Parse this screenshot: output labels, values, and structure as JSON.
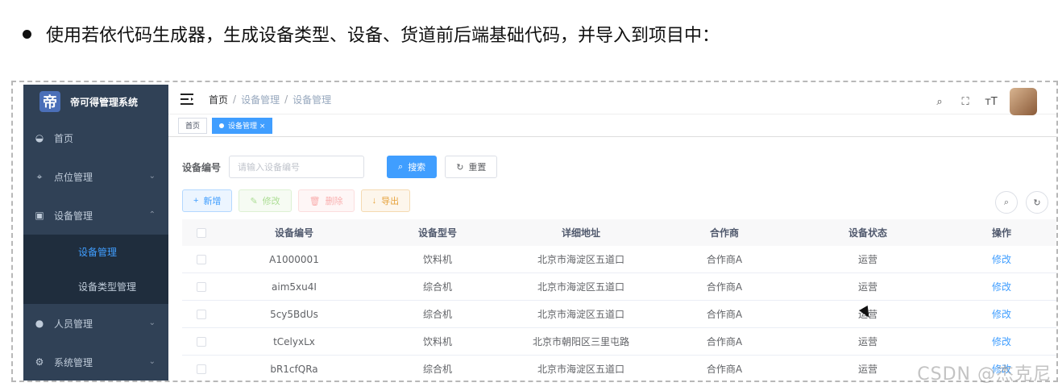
{
  "headline": "使用若依代码生成器，生成设备类型、设备、货道前后端基础代码，并导入到项目中：",
  "app": {
    "title": "帝可得管理系统",
    "logo_char": "帝"
  },
  "sidebar": {
    "items": [
      {
        "label": "首页",
        "icon": "dashboard-icon"
      },
      {
        "label": "点位管理",
        "icon": "location-icon"
      },
      {
        "label": "设备管理",
        "icon": "device-icon"
      },
      {
        "label": "人员管理",
        "icon": "people-icon"
      },
      {
        "label": "系统管理",
        "icon": "gear-icon"
      }
    ],
    "subitems": [
      {
        "label": "设备管理",
        "active": true
      },
      {
        "label": "设备类型管理",
        "active": false
      }
    ]
  },
  "breadcrumb": [
    "首页",
    "设备管理",
    "设备管理"
  ],
  "tags": [
    "首页",
    "设备管理 ×"
  ],
  "search": {
    "label": "设备编号",
    "placeholder": "请输入设备编号",
    "search_label": "搜索",
    "reset_label": "重置"
  },
  "actions": [
    "新增",
    "修改",
    "删除",
    "导出"
  ],
  "table": {
    "headers": [
      "设备编号",
      "设备型号",
      "详细地址",
      "合作商",
      "设备状态",
      "操作"
    ],
    "rows": [
      [
        "A1000001",
        "饮料机",
        "北京市海淀区五道口",
        "合作商A",
        "运营",
        "修改"
      ],
      [
        "aim5xu4I",
        "综合机",
        "北京市海淀区五道口",
        "合作商A",
        "运营",
        "修改"
      ],
      [
        "5cy5BdUs",
        "综合机",
        "北京市海淀区五道口",
        "合作商A",
        "运营",
        "修改"
      ],
      [
        "tCelyxLx",
        "饮料机",
        "北京市朝阳区三里屯路",
        "合作商A",
        "运营",
        "修改"
      ],
      [
        "bR1cfQRa",
        "综合机",
        "北京市海淀区五道口",
        "合作商A",
        "运营",
        "修改"
      ]
    ]
  },
  "watermark": "CSDN @杰克尼",
  "colors": {
    "sidebar": "#304156",
    "primary": "#409eff"
  }
}
